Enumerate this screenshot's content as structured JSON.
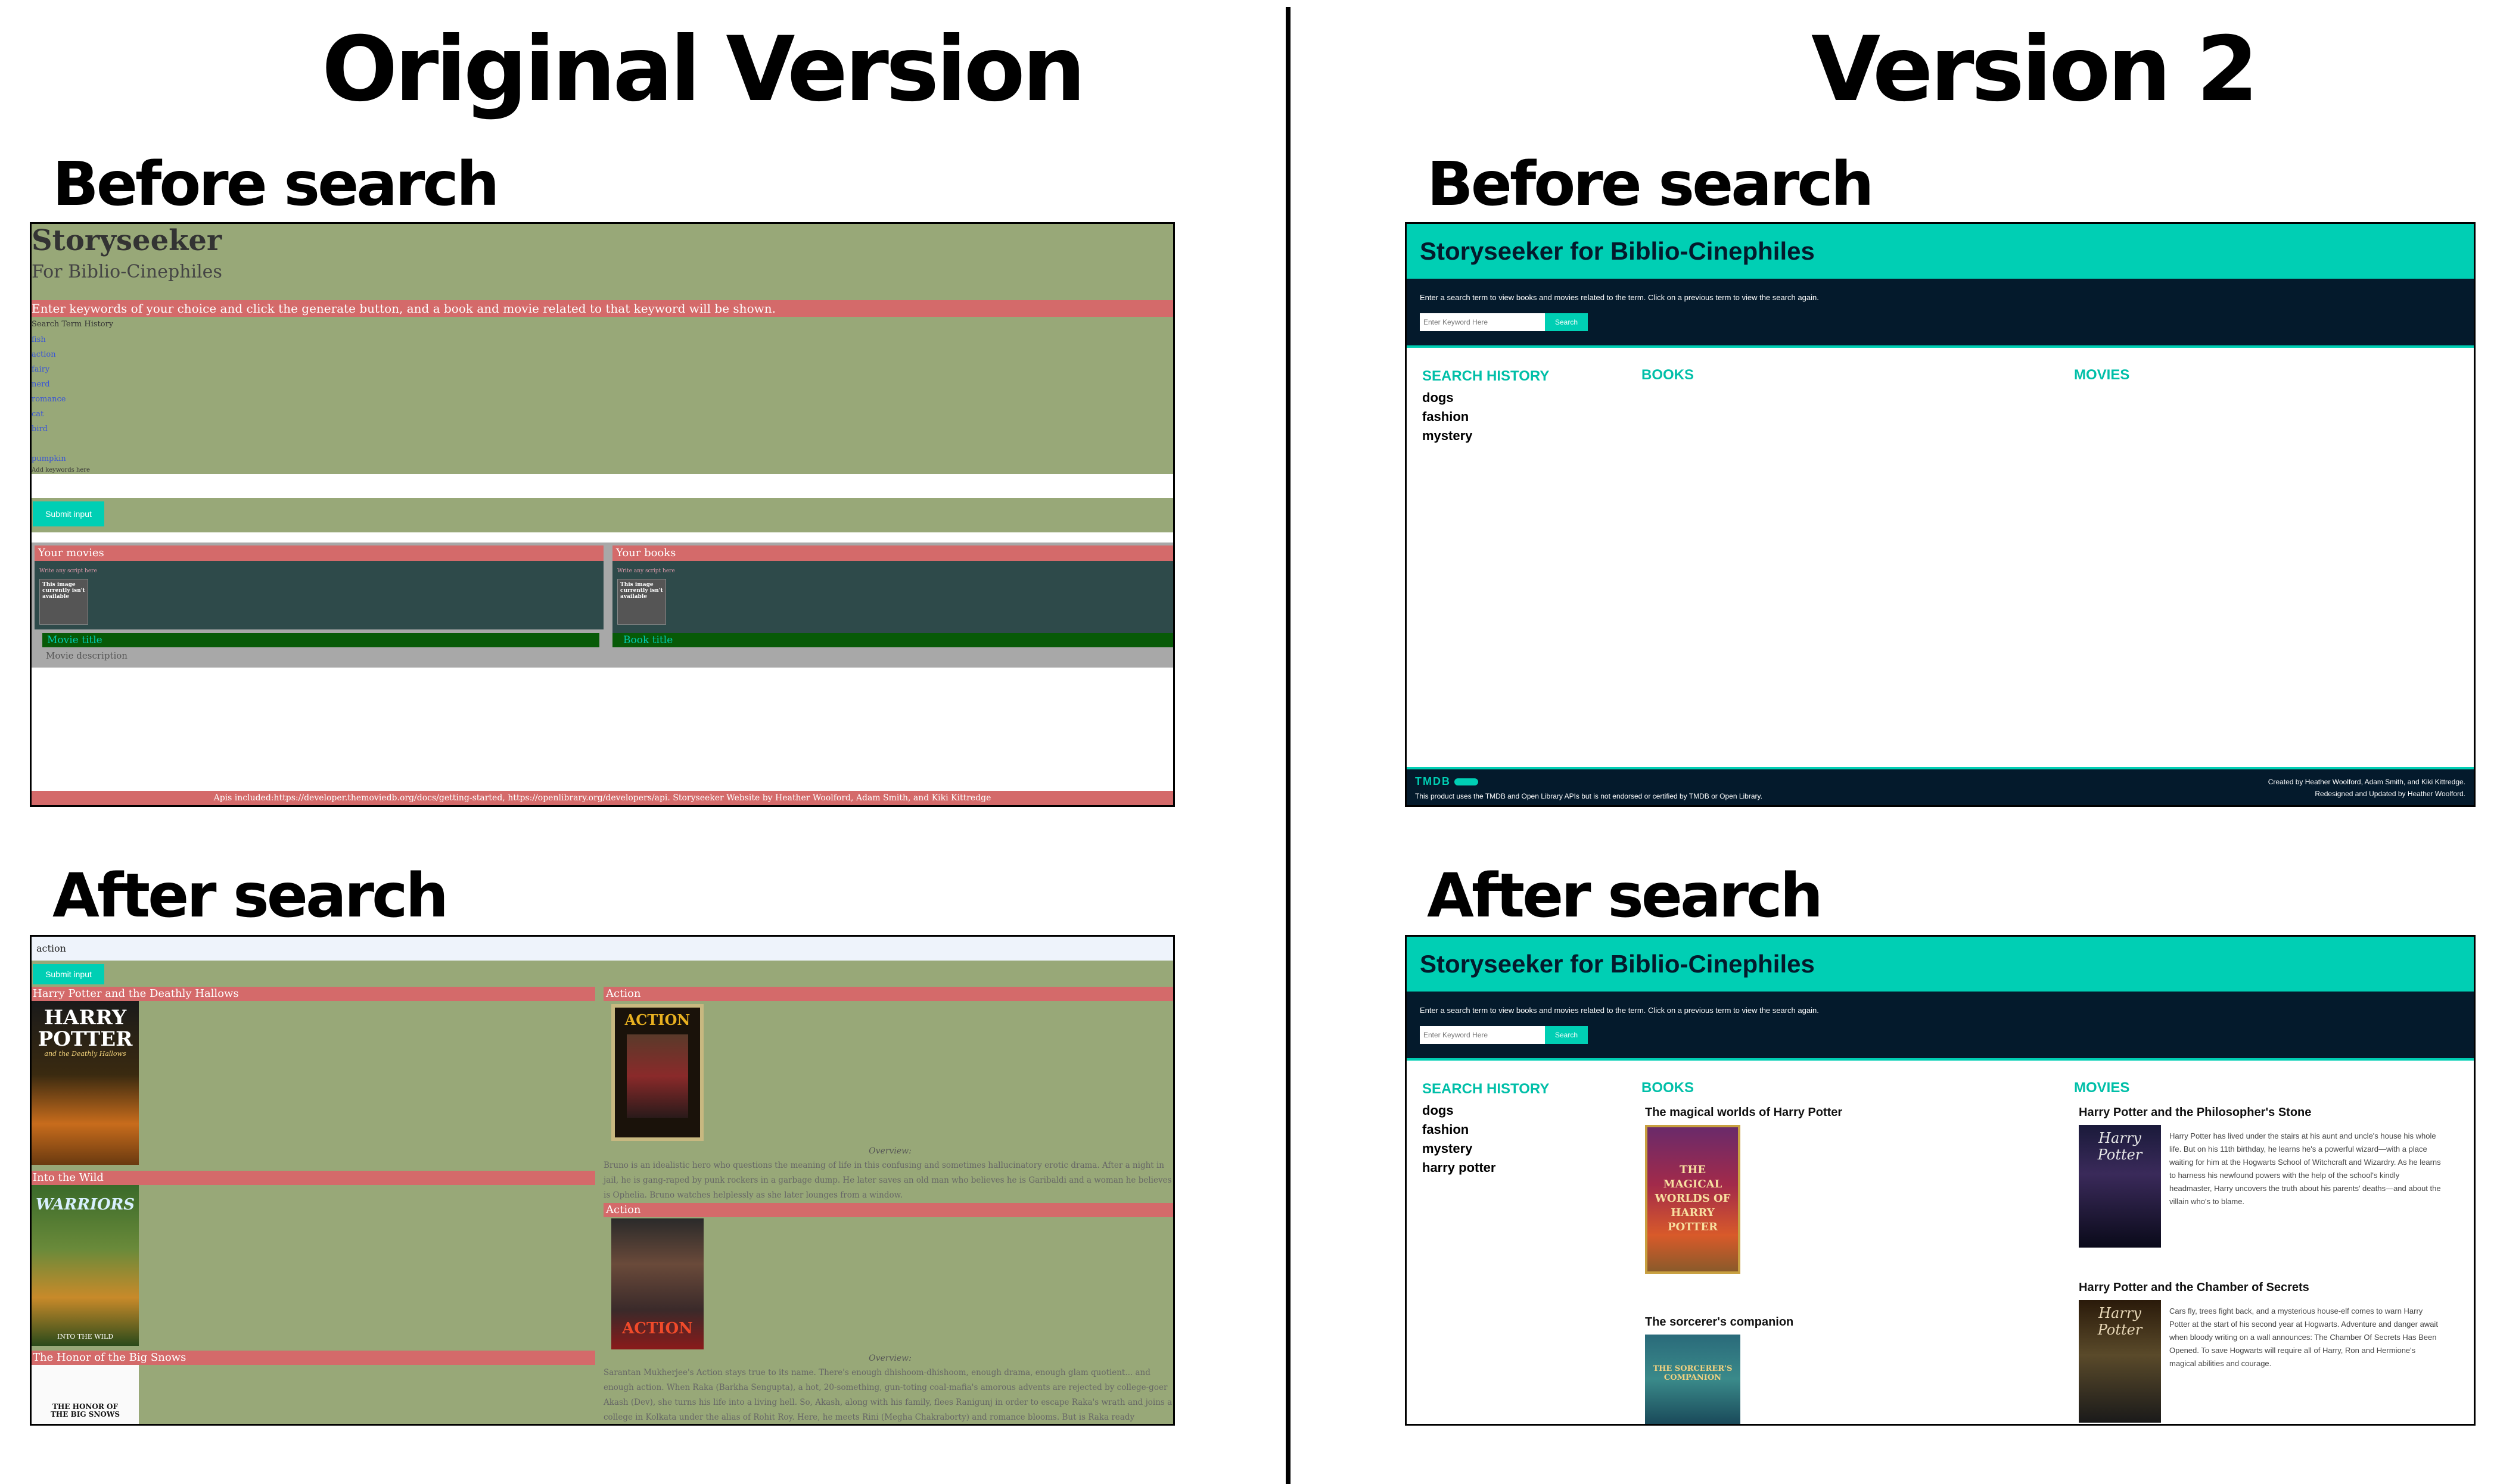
{
  "headings": {
    "original": "Original Version",
    "version2": "Version 2",
    "before": "Before search",
    "after": "After search"
  },
  "orig_before": {
    "title": "Storyseeker",
    "subtitle": "For Biblio-Cinephiles",
    "banner": "Enter keywords of your choice and click the generate button, and a book and movie related to that keyword will be shown.",
    "history_label": "Search Term History",
    "history": [
      "fish",
      "action",
      "fairy",
      "nerd",
      "romance",
      "cat",
      "bird",
      "",
      "pumpkin"
    ],
    "input_placeholder": "Add keywords here",
    "submit": "Submit input",
    "movies_header": "Your movies",
    "books_header": "Your books",
    "placeholder_small": "Write any script here",
    "img_note": "This image currently isn't available",
    "movie_title": "Movie title",
    "book_title": "Book title",
    "movie_desc": "Movie description",
    "footer": "Apis included:https://developer.themoviedb.org/docs/getting-started, https://openlibrary.org/developers/api. Storyseeker Website by Heather Woolford, Adam Smith, and Kiki Kittredge"
  },
  "orig_after": {
    "input_value": "action",
    "submit": "Submit input",
    "books": [
      {
        "title": "Harry Potter and the Deathly Hallows",
        "cover_text": "HARRY POTTER",
        "cover_sub": "and the Deathly Hallows"
      },
      {
        "title": "Into the Wild",
        "cover_text": "WARRIORS",
        "cover_sub": "INTO THE WILD"
      },
      {
        "title": "The Honor of the Big Snows",
        "cover_text": "THE HONOR OF THE BIG SNOWS",
        "cover_sub": ""
      }
    ],
    "movies": [
      {
        "title": "Action",
        "poster_text": "ACTION",
        "overview_label": "Overview:",
        "overview": "Bruno is an idealistic hero who questions the meaning of life in this confusing and sometimes hallucinatory erotic drama. After a night in jail, he is gang-raped by punk rockers in a garbage dump. He later saves an old man who believes he is Garibaldi and a woman he believes is Ophelia. Bruno watches helplessly as she later lounges from a window."
      },
      {
        "title": "Action",
        "poster_text": "ACTION",
        "overview_label": "Overview:",
        "overview": "Sarantan Mukherjee's Action stays true to its name. There's enough dhishoom-dhishoom, enough drama, enough glam quotient... and enough action. When Raka (Barkha Sengupta), a hot, 20-something, gun-toting coal-mafia's amorous advents are rejected by college-goer Akash (Dev), she turns his life into a living hell. So, Akash, along with his family, flees Ranigunj in order to escape Raka's wrath and joins a college in Kolkata under the alias of Rohit Roy. Here, he meets Rini (Megha Chakraborty) and romance blooms. But is Raka ready"
      }
    ]
  },
  "v2_before": {
    "title": "Storyseeker for Biblio-Cinephiles",
    "instructions": "Enter a search term to view books and movies related to the term. Click on a previous term to view the search again.",
    "input_placeholder": "Enter Keyword Here",
    "search": "Search",
    "history_label": "SEARCH HISTORY",
    "history": [
      "dogs",
      "fashion",
      "mystery"
    ],
    "books_label": "BOOKS",
    "movies_label": "MOVIES",
    "tmdb": "TMDB",
    "disclaimer": "This product uses the TMDB and Open Library APIs but is not endorsed or certified by TMDB or Open Library.",
    "credits_1": "Created by Heather Woolford, Adam Smith, and Kiki Kittredge.",
    "credits_2": "Redesigned and Updated by Heather Woolford."
  },
  "v2_after": {
    "title": "Storyseeker for Biblio-Cinephiles",
    "instructions": "Enter a search term to view books and movies related to the term. Click on a previous term to view the search again.",
    "input_placeholder": "Enter Keyword Here",
    "search": "Search",
    "history_label": "SEARCH HISTORY",
    "history": [
      "dogs",
      "fashion",
      "mystery",
      "harry potter"
    ],
    "books_label": "BOOKS",
    "movies_label": "MOVIES",
    "books": [
      {
        "title": "The magical worlds of Harry Potter",
        "cover_text": "THE MAGICAL WORLDS OF HARRY POTTER"
      },
      {
        "title": "The sorcerer's companion",
        "cover_text": "THE SORCERER'S COMPANION"
      }
    ],
    "movies": [
      {
        "title": "Harry Potter and the Philosopher's Stone",
        "poster_text": "Harry Potter",
        "overview": "Harry Potter has lived under the stairs at his aunt and uncle's house his whole life. But on his 11th birthday, he learns he's a powerful wizard—with a place waiting for him at the Hogwarts School of Witchcraft and Wizardry. As he learns to harness his newfound powers with the help of the school's kindly headmaster, Harry uncovers the truth about his parents' deaths—and about the villain who's to blame."
      },
      {
        "title": "Harry Potter and the Chamber of Secrets",
        "poster_text": "Harry Potter",
        "overview": "Cars fly, trees fight back, and a mysterious house-elf comes to warn Harry Potter at the start of his second year at Hogwarts. Adventure and danger await when bloody writing on a wall announces: The Chamber Of Secrets Has Been Opened. To save Hogwarts will require all of Harry, Ron and Hermione's magical abilities and courage."
      }
    ]
  }
}
